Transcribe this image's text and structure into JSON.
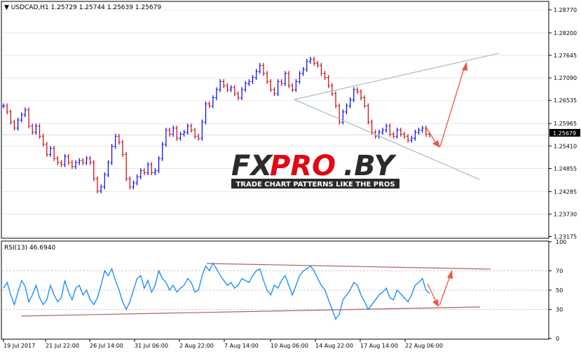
{
  "colors": {
    "grid": "#d9d9d9",
    "frame": "#000000",
    "bar_up": "#0000ff",
    "bar_down": "#cc0000",
    "wedge": "#a9bfd4",
    "arrow": "#ee5544",
    "rsi_line": "#1e90ff",
    "rsi_trend": "#b06060",
    "watermark_dark": "#2b2b2b",
    "watermark_red": "#e30613"
  },
  "watermark": {
    "fx": "FX",
    "pro": "PRO",
    "by": ".BY",
    "tagline": "TRADE CHART PATTERNS LIKE THE PROS"
  },
  "chart_data": [
    {
      "type": "line",
      "symbol_header": "USDCAD,H1  1.25729 1.25744 1.25639 1.25679",
      "title": "USDCAD,H1",
      "ohlc_last": {
        "open": 1.25729,
        "high": 1.25744,
        "low": 1.25639,
        "close": 1.25679
      },
      "last_price_label": "1.25679",
      "ylim": [
        1.2315,
        1.2896
      ],
      "y_ticks": [
        "1.28770",
        "1.28200",
        "1.27645",
        "1.27090",
        "1.26535",
        "1.25965",
        "1.25410",
        "1.24855",
        "1.24285",
        "1.23730",
        "1.23175"
      ],
      "x_ticks": [
        "19 Jul 2017",
        "21 Jul 22:00",
        "26 Jul 14:00",
        "31 Jul 06:00",
        "2 Aug 22:00",
        "7 Aug 14:00",
        "10 Aug 06:00",
        "14 Aug 22:00",
        "17 Aug 14:00",
        "22 Aug 06:00"
      ],
      "grid": true,
      "series": [
        {
          "values": [
            1.264,
            1.2625,
            1.26,
            1.2585,
            1.2605,
            1.2618,
            1.263,
            1.259,
            1.2575,
            1.259,
            1.2565,
            1.2545,
            1.252,
            1.2535,
            1.251,
            1.25,
            1.2495,
            1.2515,
            1.25,
            1.249,
            1.25,
            1.2505,
            1.25,
            1.251,
            1.25,
            1.246,
            1.243,
            1.244,
            1.247,
            1.25,
            1.254,
            1.2565,
            1.255,
            1.252,
            1.246,
            1.244,
            1.245,
            1.2465,
            1.248,
            1.2475,
            1.2495,
            1.2475,
            1.248,
            1.251,
            1.2545,
            1.258,
            1.257,
            1.2585,
            1.256,
            1.257,
            1.2575,
            1.259,
            1.258,
            1.2565,
            1.256,
            1.26,
            1.2645,
            1.264,
            1.266,
            1.268,
            1.27,
            1.269,
            1.268,
            1.2685,
            1.267,
            1.266,
            1.268,
            1.2695,
            1.27,
            1.271,
            1.2725,
            1.274,
            1.272,
            1.27,
            1.268,
            1.267,
            1.27,
            1.2695,
            1.272,
            1.269,
            1.268,
            1.27,
            1.272,
            1.273,
            1.275,
            1.2755,
            1.2745,
            1.274,
            1.272,
            1.271,
            1.269,
            1.267,
            1.264,
            1.26,
            1.2625,
            1.264,
            1.2655,
            1.268,
            1.2675,
            1.266,
            1.264,
            1.26,
            1.2575,
            1.2565,
            1.2575,
            1.258,
            1.259,
            1.257,
            1.2565,
            1.258,
            1.257,
            1.2565,
            1.2555,
            1.256,
            1.2575,
            1.258,
            1.2585,
            1.257,
            1.2568
          ]
        }
      ],
      "annotations": [
        "Broadening wedge drawn from 10 Aug: upper line rising toward 1.2765, lower line falling toward 1.2465",
        "Red arrows: dip to about 1.2545 then rise toward about 1.2745"
      ]
    },
    {
      "type": "line",
      "title": "RSI(13) 46.6940",
      "indicator": "RSI(13)",
      "last_value": 46.694,
      "ylim": [
        0,
        100
      ],
      "y_ticks": [
        "100",
        "70",
        "50",
        "30",
        "0"
      ],
      "grid": true,
      "series": [
        {
          "values": [
            52,
            58,
            45,
            35,
            48,
            60,
            54,
            38,
            45,
            55,
            42,
            35,
            40,
            55,
            45,
            38,
            42,
            60,
            48,
            40,
            52,
            55,
            45,
            50,
            40,
            35,
            42,
            55,
            70,
            65,
            72,
            60,
            50,
            38,
            30,
            38,
            50,
            62,
            65,
            52,
            60,
            48,
            55,
            70,
            62,
            58,
            50,
            55,
            48,
            52,
            55,
            62,
            58,
            48,
            50,
            65,
            75,
            70,
            78,
            72,
            65,
            60,
            55,
            58,
            52,
            55,
            62,
            60,
            58,
            65,
            70,
            72,
            60,
            50,
            45,
            55,
            52,
            60,
            65,
            55,
            45,
            55,
            65,
            70,
            72,
            75,
            70,
            62,
            55,
            50,
            40,
            30,
            20,
            25,
            40,
            45,
            50,
            58,
            55,
            45,
            38,
            30,
            35,
            40,
            45,
            48,
            52,
            42,
            40,
            50,
            46,
            42,
            38,
            45,
            55,
            58,
            62,
            50,
            46.7
          ]
        }
      ],
      "annotations": [
        "Upper trend line from about 78 declining to about 72",
        "Lower trend line rising from about 22 to about 32",
        "Red arrows: dip to about 30 then rise toward about 68"
      ]
    }
  ]
}
